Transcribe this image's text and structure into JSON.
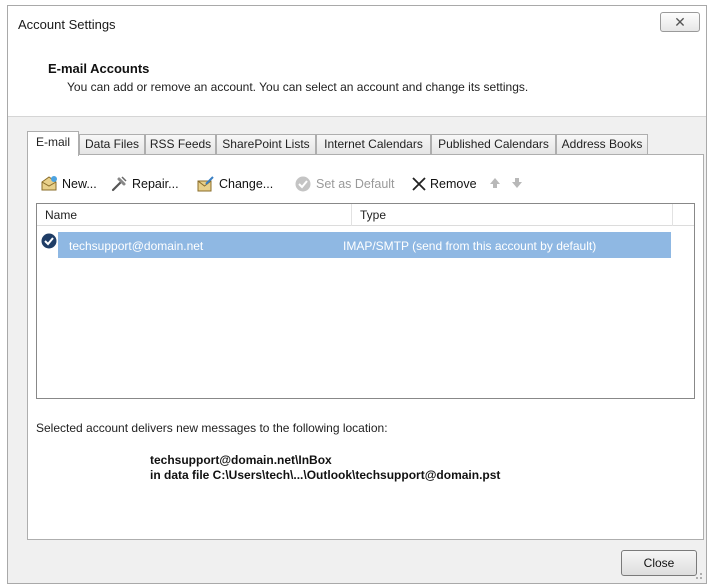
{
  "window": {
    "title": "Account Settings",
    "close_glyph": "✕"
  },
  "header": {
    "title": "E-mail Accounts",
    "description": "You can add or remove an account. You can select an account and change its settings."
  },
  "tabs": [
    {
      "label": "E-mail",
      "active": true
    },
    {
      "label": "Data Files",
      "active": false
    },
    {
      "label": "RSS Feeds",
      "active": false
    },
    {
      "label": "SharePoint Lists",
      "active": false
    },
    {
      "label": "Internet Calendars",
      "active": false
    },
    {
      "label": "Published Calendars",
      "active": false
    },
    {
      "label": "Address Books",
      "active": false
    }
  ],
  "toolbar": {
    "new_label": "New...",
    "repair_label": "Repair...",
    "change_label": "Change...",
    "set_default_label": "Set as Default",
    "remove_label": "Remove",
    "icons": [
      "new-account-icon",
      "repair-icon",
      "change-icon",
      "set-default-icon",
      "remove-icon",
      "move-up-icon",
      "move-down-icon"
    ]
  },
  "accounts_list": {
    "columns": [
      "Name",
      "Type"
    ],
    "rows": [
      {
        "name": "techsupport@domain.net",
        "type": "IMAP/SMTP (send from this account by default)",
        "selected": true,
        "default": true
      }
    ]
  },
  "delivery": {
    "label": "Selected account delivers new messages to the following location:",
    "folder": "techsupport@domain.net\\InBox",
    "data_file": "in data file C:\\Users\\tech\\...\\Outlook\\techsupport@domain.pst"
  },
  "footer": {
    "close_label": "Close"
  },
  "colors": {
    "selection": "#8fb8e3",
    "window_bg": "#f0f0f0",
    "default_check": "#1f3d66"
  }
}
